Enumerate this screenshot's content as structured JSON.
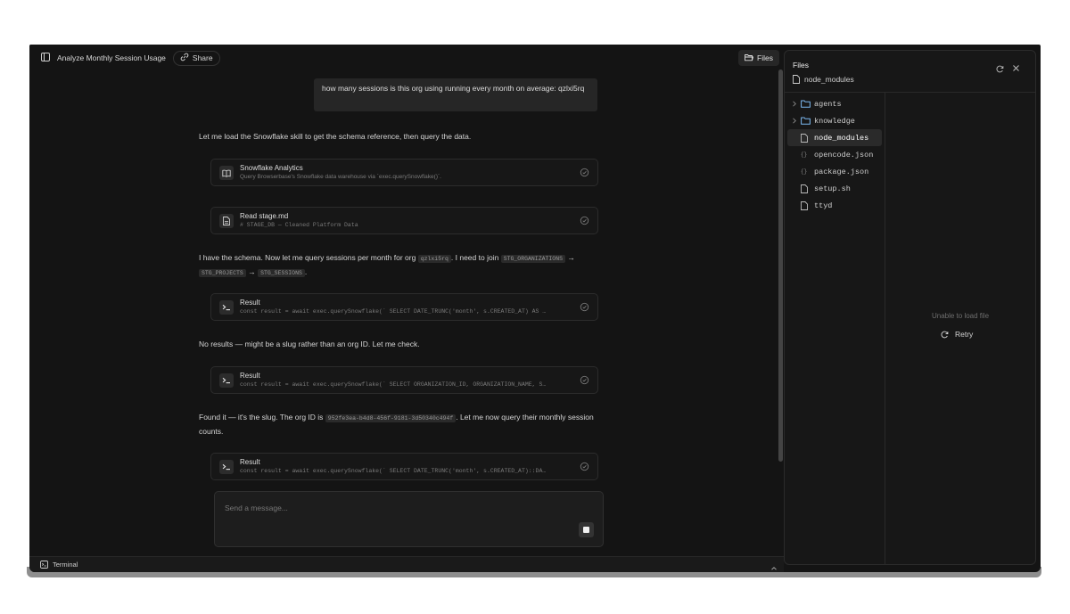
{
  "header": {
    "title": "Analyze Monthly Session Usage",
    "share_label": "Share",
    "files_label": "Files"
  },
  "messages": {
    "user": "how many sessions is this org using running every month on average: qzlxi5rq",
    "p1": "Let me load the Snowflake skill to get the schema reference, then query the data.",
    "card1": {
      "title": "Snowflake Analytics",
      "subtitle": "Query Browserbase's Snowflake data warehouse via `exec.querySnowflake()`."
    },
    "card2": {
      "title": "Read stage.md",
      "subtitle": "# STAGE_DB — Cleaned Platform Data"
    },
    "p2": {
      "a": "I have the schema. Now let me query sessions per month for org",
      "org_chip": "qzlxi5rq",
      "b": ". I need to join",
      "chip1": "STG_ORGANIZATIONS",
      "arrow1": "→",
      "chip2": "STG_PROJECTS",
      "arrow2": "→",
      "chip3": "STG_SESSIONS",
      "end": "."
    },
    "card3": {
      "title": "Result",
      "subtitle": "const result = await exec.querySnowflake(` SELECT DATE_TRUNC('month', s.CREATED_AT) AS …"
    },
    "p3": "No results — might be a slug rather than an org ID. Let me check.",
    "card4": {
      "title": "Result",
      "subtitle": "const result = await exec.querySnowflake(` SELECT ORGANIZATION_ID, ORGANIZATION_NAME, S…"
    },
    "p4": {
      "a": "Found it — it's the slug. The org ID is",
      "chip": "952fe3ea-b4d8-456f-9181-3d50340c494f",
      "b": ". Let me now query their monthly session counts."
    },
    "card5": {
      "title": "Result",
      "subtitle": "const result = await exec.querySnowflake(` SELECT DATE_TRUNC('month', s.CREATED_AT)::DA…"
    }
  },
  "composer": {
    "placeholder": "Send a message..."
  },
  "terminal": {
    "label": "Terminal"
  },
  "files_panel": {
    "title": "Files",
    "current_path": "node_modules",
    "tree": [
      {
        "name": "agents",
        "kind": "folder"
      },
      {
        "name": "knowledge",
        "kind": "folder"
      },
      {
        "name": "node_modules",
        "kind": "file",
        "selected": true
      },
      {
        "name": "opencode.json",
        "kind": "json"
      },
      {
        "name": "package.json",
        "kind": "json"
      },
      {
        "name": "setup.sh",
        "kind": "file"
      },
      {
        "name": "ttyd",
        "kind": "file"
      }
    ],
    "json_glyph": "{}",
    "empty_text": "Unable to load file",
    "retry_label": "Retry"
  },
  "colors": {
    "background": "#141414",
    "panel": "#171717",
    "folder_icon": "#7cb8f0"
  }
}
